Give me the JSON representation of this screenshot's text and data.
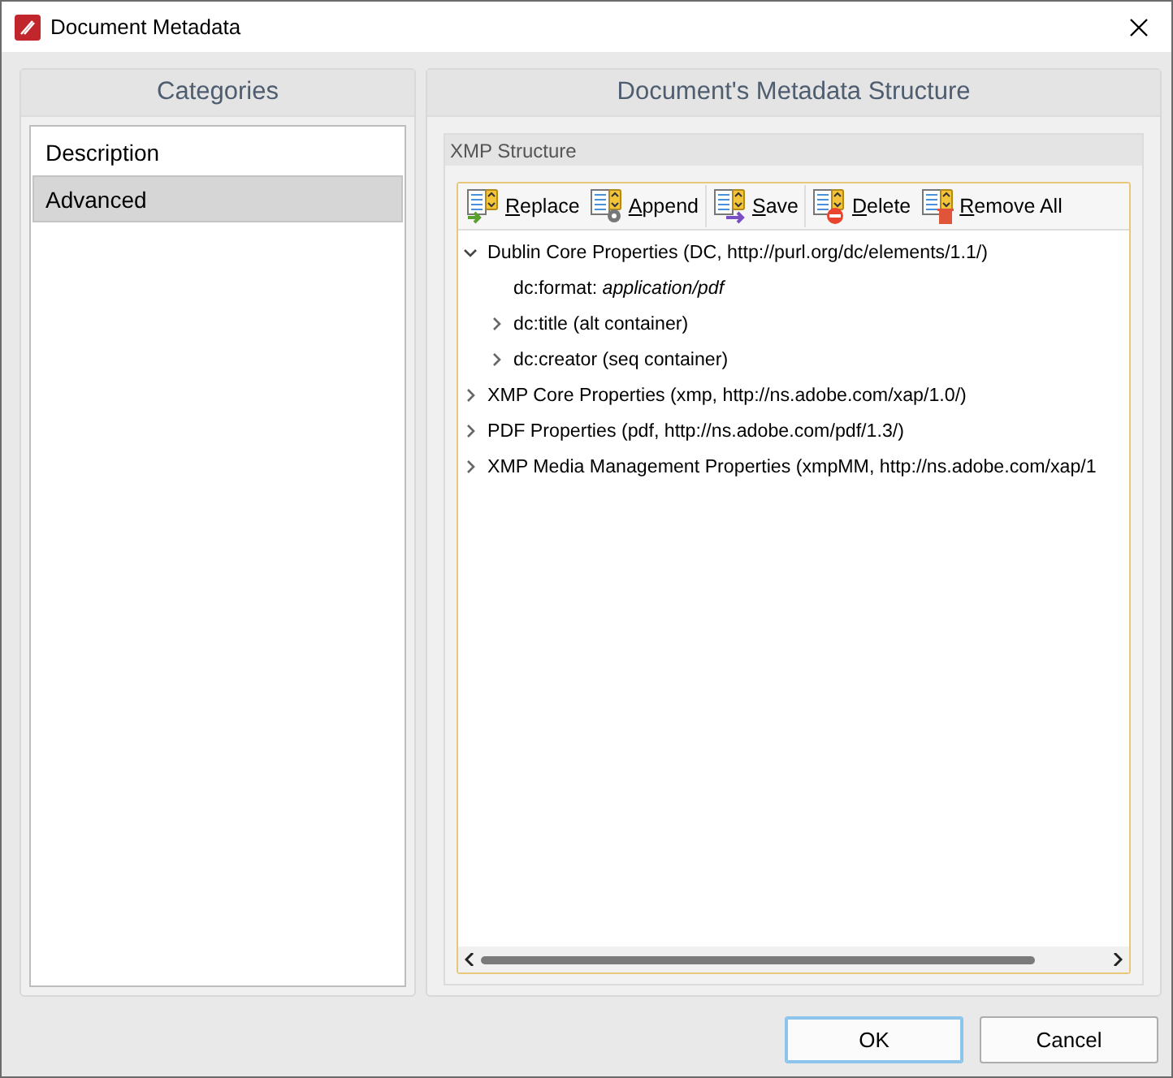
{
  "window": {
    "title": "Document Metadata"
  },
  "categories": {
    "title": "Categories",
    "items": [
      {
        "label": "Description",
        "selected": false
      },
      {
        "label": "Advanced",
        "selected": true
      }
    ]
  },
  "structure": {
    "title": "Document's Metadata Structure",
    "group_title": "XMP Structure",
    "toolbar": [
      {
        "kind": "replace",
        "label": "Replace"
      },
      {
        "kind": "append",
        "label": "Append"
      },
      {
        "kind": "save",
        "label": "Save"
      },
      {
        "kind": "delete",
        "label": "Delete"
      },
      {
        "kind": "remove_all",
        "label": "Remove All"
      }
    ],
    "tree": [
      {
        "label": "Dublin Core Properties (DC, http://purl.org/dc/elements/1.1/)",
        "expanded": true,
        "children": [
          {
            "label": "dc:format: *application/pdf*"
          },
          {
            "label": "dc:title (alt container)",
            "expanded": false
          },
          {
            "label": "dc:creator (seq container)",
            "expanded": false
          }
        ]
      },
      {
        "label": "XMP Core Properties (xmp, http://ns.adobe.com/xap/1.0/)",
        "expanded": false
      },
      {
        "label": "PDF Properties (pdf, http://ns.adobe.com/pdf/1.3/)",
        "expanded": false
      },
      {
        "label": "XMP Media Management Properties (xmpMM, http://ns.adobe.com/xap/1",
        "expanded": false
      }
    ]
  },
  "buttons": [
    {
      "label": "OK",
      "default": true
    },
    {
      "label": "Cancel",
      "default": false
    }
  ]
}
